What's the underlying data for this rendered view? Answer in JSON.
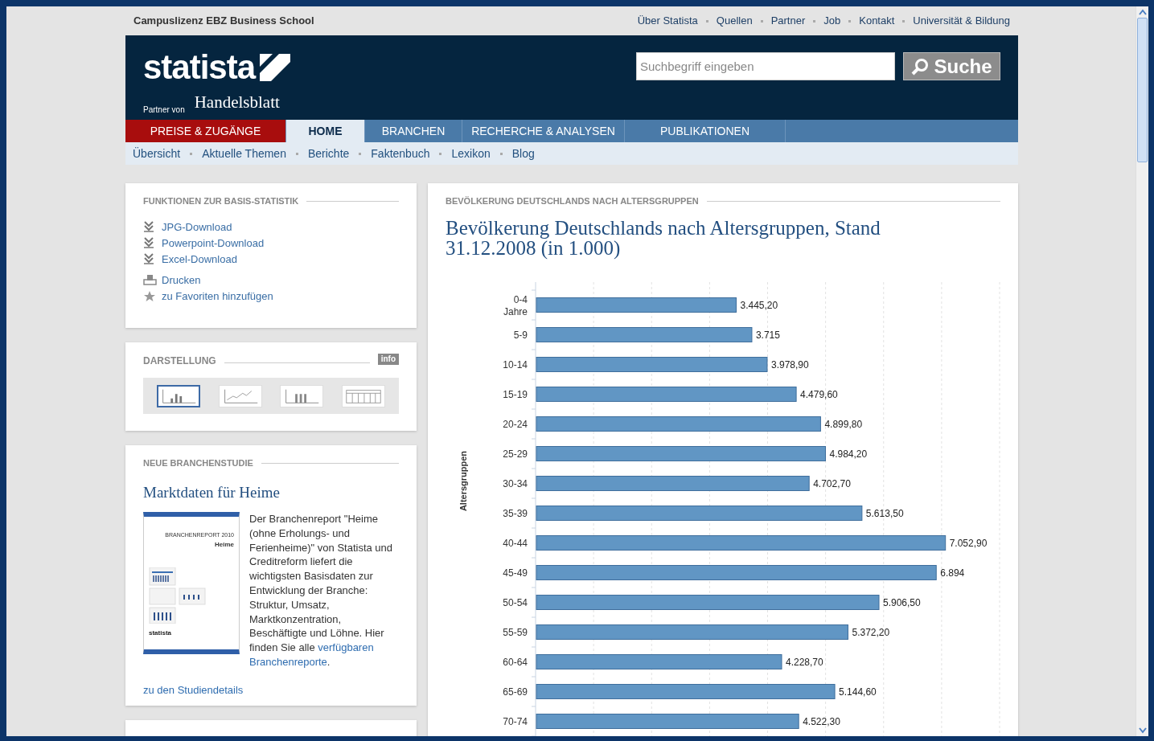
{
  "top_bar": {
    "license": "Campuslizenz EBZ Business School",
    "links": [
      "Über Statista",
      "Quellen",
      "Partner",
      "Job",
      "Kontakt",
      "Universität & Bildung"
    ]
  },
  "header": {
    "logo": "statista",
    "partner_label": "Partner von",
    "partner": "Handelsblatt",
    "search": {
      "placeholder": "Suchbegriff eingeben"
    },
    "search_button": "Suche"
  },
  "nav": [
    {
      "label": "PREISE & ZUGÄNGE",
      "kind": "promo",
      "selected": false
    },
    {
      "label": "HOME",
      "kind": "tab",
      "selected": true
    },
    {
      "label": "BRANCHEN",
      "kind": "tab",
      "selected": false
    },
    {
      "label": "RECHERCHE & ANALYSEN",
      "kind": "tab",
      "selected": false
    },
    {
      "label": "PUBLIKATIONEN",
      "kind": "tab",
      "selected": false
    }
  ],
  "subnav": [
    "Übersicht",
    "Aktuelle Themen",
    "Berichte",
    "Faktenbuch",
    "Lexikon",
    "Blog"
  ],
  "functions": {
    "heading": "FUNKTIONEN ZUR BASIS-STATISTIK",
    "groups": [
      [
        {
          "label": "JPG-Download",
          "kind": "download"
        },
        {
          "label": "Powerpoint-Download",
          "kind": "download"
        },
        {
          "label": "Excel-Download",
          "kind": "download"
        }
      ],
      [
        {
          "label": "Drucken",
          "kind": "print"
        },
        {
          "label": "zu Favoriten hinzufügen",
          "kind": "favorite"
        }
      ]
    ]
  },
  "display": {
    "heading": "DARSTELLUNG",
    "info": "info",
    "chart_types": [
      {
        "kind": "bar",
        "selected": true
      },
      {
        "kind": "line",
        "selected": false
      },
      {
        "kind": "stacked",
        "selected": false
      },
      {
        "kind": "grid",
        "selected": false
      }
    ]
  },
  "study": {
    "heading": "NEUE BRANCHENSTUDIE",
    "title": "Marktdaten für Heime",
    "cover_title": "BRANCHENREPORT 2010",
    "cover_subtitle": "Heime",
    "cover_logo": "statista",
    "text": "Der Branchenreport \"Heime (ohne Erholungs- und Ferienheime)\" von Statista und Creditreform liefert die wichtigsten Basisdaten zur Entwicklung der Branche: Struktur, Umsatz, Marktkonzentration, Beschäftigte und Löhne. Hier finden Sie alle ",
    "link_lines": [
      "verfügbaren",
      "Branchenreporte"
    ],
    "after": ".",
    "details": "zu den Studiendetails"
  },
  "main": {
    "heading": "BEVÖLKERUNG DEUTSCHLANDS NACH ALTERSGRUPPEN",
    "title": "Bevölkerung Deutschlands nach Altersgruppen, Stand 31.12.2008 (in 1.000)",
    "chart_data": {
      "type": "bar",
      "orientation": "horizontal",
      "ylabel": "Altersgruppen",
      "categories": [
        "0-4 Jahre",
        "5-9",
        "10-14",
        "15-19",
        "20-24",
        "25-29",
        "30-34",
        "35-39",
        "40-44",
        "45-49",
        "50-54",
        "55-59",
        "60-64",
        "65-69",
        "70-74"
      ],
      "series": [
        {
          "color": "#6196c4",
          "values": [
            3445.2,
            3715,
            3978.9,
            4479.6,
            4899.8,
            4984.2,
            4702.7,
            5613.5,
            7052.9,
            6894,
            5906.5,
            5372.2,
            4228.7,
            5144.6,
            4522.3
          ],
          "value_labels": [
            "3.445,20",
            "3.715",
            "3.978,90",
            "4.479,60",
            "4.899,80",
            "4.984,20",
            "4.702,70",
            "5.613,50",
            "7.052,90",
            "6.894",
            "5.906,50",
            "5.372,20",
            "4.228,70",
            "5.144,60",
            "4.522,30"
          ]
        }
      ]
    }
  }
}
